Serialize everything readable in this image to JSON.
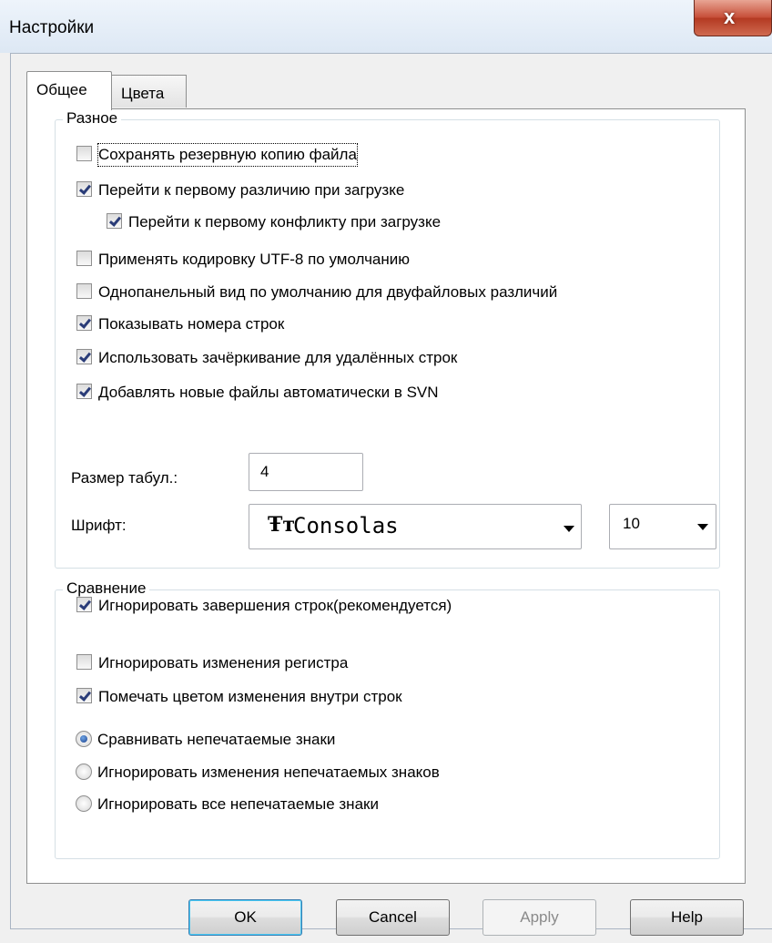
{
  "window": {
    "title": "Настройки",
    "close_glyph": "x"
  },
  "tabs": [
    {
      "label": "Общее",
      "active": true
    },
    {
      "label": "Цвета",
      "active": false
    }
  ],
  "misc_group": {
    "title": "Разное",
    "options": [
      {
        "label": "Сохранять резервную копию файла",
        "checked": false,
        "focused": true
      },
      {
        "label": "Перейти к первому различию при загрузке",
        "checked": true
      },
      {
        "label": "Перейти к первому конфликту при загрузке",
        "checked": true,
        "indented": true
      },
      {
        "label": "Применять кодировку UTF-8 по умолчанию",
        "checked": false
      },
      {
        "label": "Однопанельный вид по умолчанию для двуфайловых различий",
        "checked": false
      },
      {
        "label": "Показывать номера строк",
        "checked": true
      },
      {
        "label": "Использовать зачёркивание для удалённых строк",
        "checked": true
      },
      {
        "label": "Добавлять новые файлы автоматически в SVN",
        "checked": true
      }
    ],
    "tab_size_label": "Размер табул.:",
    "tab_size_value": "4",
    "font_label": "Шрифт:",
    "font_icon": "Ŧт",
    "font_value": "Consolas",
    "font_size_value": "10"
  },
  "compare_group": {
    "title": "Сравнение",
    "options": [
      {
        "label": "Игнорировать завершения строк(рекомендуется)",
        "checked": true
      },
      {
        "label": "Игнорировать изменения регистра",
        "checked": false
      },
      {
        "label": "Помечать цветом изменения внутри строк",
        "checked": true
      }
    ],
    "radios": [
      {
        "label": "Сравнивать непечатаемые знаки",
        "selected": true
      },
      {
        "label": "Игнорировать изменения непечатаемых знаков",
        "selected": false
      },
      {
        "label": "Игнорировать все непечатаемые знаки",
        "selected": false
      }
    ]
  },
  "buttons": {
    "ok": "OK",
    "cancel": "Cancel",
    "apply": "Apply",
    "help": "Help"
  },
  "colors": {
    "checkmark": "#2a3c78",
    "close_button": "#c7503a",
    "default_button_border": "#3c7fb1"
  }
}
